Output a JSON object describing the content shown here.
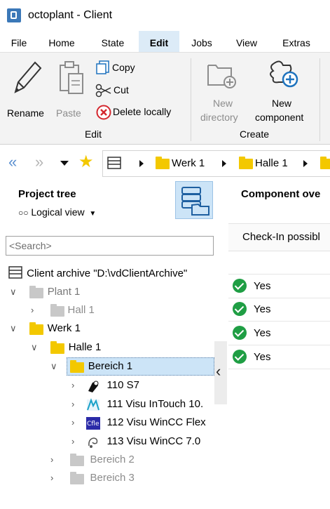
{
  "window": {
    "title": "octoplant - Client"
  },
  "menu": {
    "items": [
      "File",
      "Home",
      "State",
      "Edit",
      "Jobs",
      "View",
      "Extras"
    ],
    "active": "Edit"
  },
  "ribbon": {
    "edit_group": {
      "label": "Edit",
      "rename": "Rename",
      "paste": "Paste",
      "copy": "Copy",
      "cut": "Cut",
      "delete_locally": "Delete locally"
    },
    "create_group": {
      "label": "Create",
      "new_directory_line1": "New",
      "new_directory_line2": "directory",
      "new_component_line1": "New",
      "new_component_line2": "component"
    }
  },
  "path": {
    "segments": [
      "Werk 1",
      "Halle 1"
    ]
  },
  "left_pane": {
    "title": "Project tree",
    "view_selector": "Logical view",
    "search_placeholder": "<Search>",
    "tree": {
      "root": "Client archive \"D:\\vdClientArchive\"",
      "plant1": "Plant 1",
      "hall1": "Hall 1",
      "werk1": "Werk 1",
      "halle1": "Halle 1",
      "bereich1": "Bereich 1",
      "c110": "110 S7",
      "c111": "111 Visu InTouch 10.",
      "c112": "112 Visu WinCC Flex",
      "c113": "113 Visu WinCC 7.0",
      "bereich2": "Bereich 2",
      "bereich3": "Bereich 3"
    }
  },
  "right_pane": {
    "title": "Component ove",
    "column_header": "Check-In possibl",
    "rows": [
      "Yes",
      "Yes",
      "Yes",
      "Yes"
    ]
  },
  "colors": {
    "accent": "#1e73be",
    "folder": "#f3c800",
    "selected": "#cce4f7",
    "check": "#1f9e44"
  }
}
